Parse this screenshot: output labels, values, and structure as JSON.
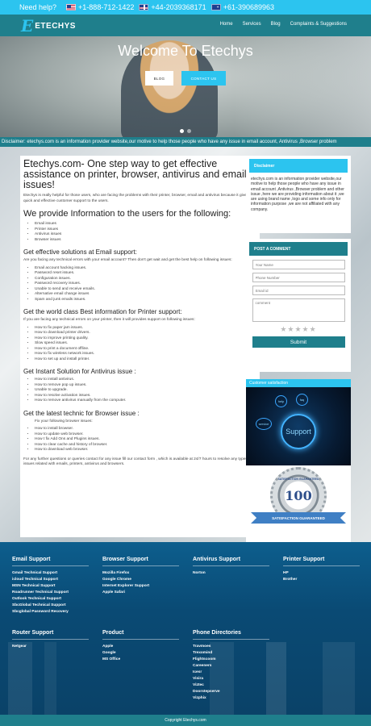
{
  "topbar": {
    "help": "Need help?",
    "phones": [
      "+1-888-712-1422",
      "+44-2039368171",
      "+61-390689963"
    ]
  },
  "brand": {
    "name": "ETECHYS"
  },
  "nav": [
    "Home",
    "Services",
    "Blog",
    "Complaints & Suggestions"
  ],
  "hero": {
    "title": "Welcome To Etechys",
    "blog_button": "BLOG",
    "contact_button": "CONTACT US"
  },
  "marquee": "Disclaimer: etechys.com is an information provider website,our motive to help those people who have any issue in email account, Antivirus ,Browser problem",
  "content": {
    "title": "Etechys.com- One step way to get effective assistance on printer, browser, antivirus and email issues!",
    "intro": "Etechys is really helpful for those users, who are facing the problems with their printer, browser, email and antivirus because it gives quick and effective customer support to the users.",
    "info_heading": "We provide Information to the users for the following:",
    "info_items": [
      "Email issues",
      "Printer issues",
      "Antivirus issues",
      "Browser issues"
    ],
    "email_heading": "Get effective solutions at Email support:",
    "email_intro": "Are you facing any technical errors with your email account? Then don't get wait and get the best help on following issues:",
    "email_items": [
      "Email account hacking issues.",
      "Password reset issues.",
      "Configuration issues.",
      "Password recovery issues.",
      "Unable to send and receive emails.",
      "Alternative email change issues",
      "Spam and junk emails issues."
    ],
    "printer_heading": "Get the world class Best information for Printer support:",
    "printer_intro": "If you are facing any technical errors on your printer, then it will provides support on following issues:",
    "printer_items": [
      "How to fix paper jam issues.",
      "How to download printer drivers.",
      "How to improve printing quality.",
      "Slow speed issues.",
      "How to print a document offline.",
      "How to fix wireless network issues.",
      "How to set up and install printer."
    ],
    "antivirus_heading": "Get Instant Solution for Antivirus issue :",
    "antivirus_items": [
      "How to install antivirus.",
      "How to remove pop up issues.",
      "Unable to upgrade.",
      "How to resolve activation issues.",
      "How to remove antivirus manually from the computer."
    ],
    "browser_heading": "Get the latest technic for Browser issue :",
    "browser_intro": "Fix your following browser issues:",
    "browser_items": [
      "How to install browser.",
      "How to update web browser.",
      "How t fix Add Ons and Plugins issues.",
      "How to clear cache and history of browser.",
      "How to download web browser."
    ],
    "closing": "For any further questions or queries contact for any issue fill our contact form , which is available at 24/7 hours to resolve any types of issues related with emails, printers, antivirus and browsers."
  },
  "disclaimer": {
    "heading": "Disclaimer",
    "text": "etechys.com is an information provider website,our motive to help those people who have any issue in email account ,Antivirus ,Browser problem and other issue ,here we are providing information about it ,we are using brand name ,logo and some info only for information purpose ,we are not affiliated with any company."
  },
  "comment_form": {
    "heading": "POST A COMMENT",
    "name_placeholder": "Your Name",
    "phone_placeholder": "Phone Number",
    "email_placeholder": "Email id",
    "comment_placeholder": "comment",
    "stars": "★★★★★",
    "submit": "Submit"
  },
  "satisfaction": {
    "heading": "Customer satisfaction",
    "support_label": "Support",
    "bubbles": [
      "help",
      "faq",
      "service"
    ],
    "badge_number": "100",
    "badge_top": "SATISFACTION GUARANTEED",
    "ribbon": "SATISFACTION GUARANTEED"
  },
  "footer": {
    "columns": [
      {
        "heading": "Email Support",
        "items": [
          "Gmail Technical Support",
          "icloud Technical Support",
          "MSN Technical Support",
          "Roadrunner Technical Support",
          "Outlook Technical Support",
          "SbcGlobal Technical Support",
          "Sbcglobal Password Recovery"
        ]
      },
      {
        "heading": "Browser Support",
        "items": [
          "Mozilla Firefox",
          "Google Chrome",
          "Internet Explorer Support",
          "Apple Safari"
        ]
      },
      {
        "heading": "Antivirus Support",
        "items": [
          "Norton"
        ]
      },
      {
        "heading": "Printer Support",
        "items": [
          "HP",
          "Brother"
        ]
      },
      {
        "heading": "Router Support",
        "items": [
          "Netgear"
        ]
      },
      {
        "heading": "Product",
        "items": [
          "Apple",
          "Google",
          "MS Office"
        ]
      },
      {
        "heading": "Phone Directories",
        "items": [
          "Travmoes",
          "Trexomind",
          "Flightscoom",
          "Careeners",
          "Icesr",
          "Visira",
          "Viztec",
          "Doorstepserve",
          "Vizphix"
        ]
      }
    ],
    "copyright": "Copyright Etechys.com"
  },
  "colors": {
    "accent": "#2cc4ef",
    "teal": "#1f7f8c",
    "footer": "#0d5e8d"
  }
}
